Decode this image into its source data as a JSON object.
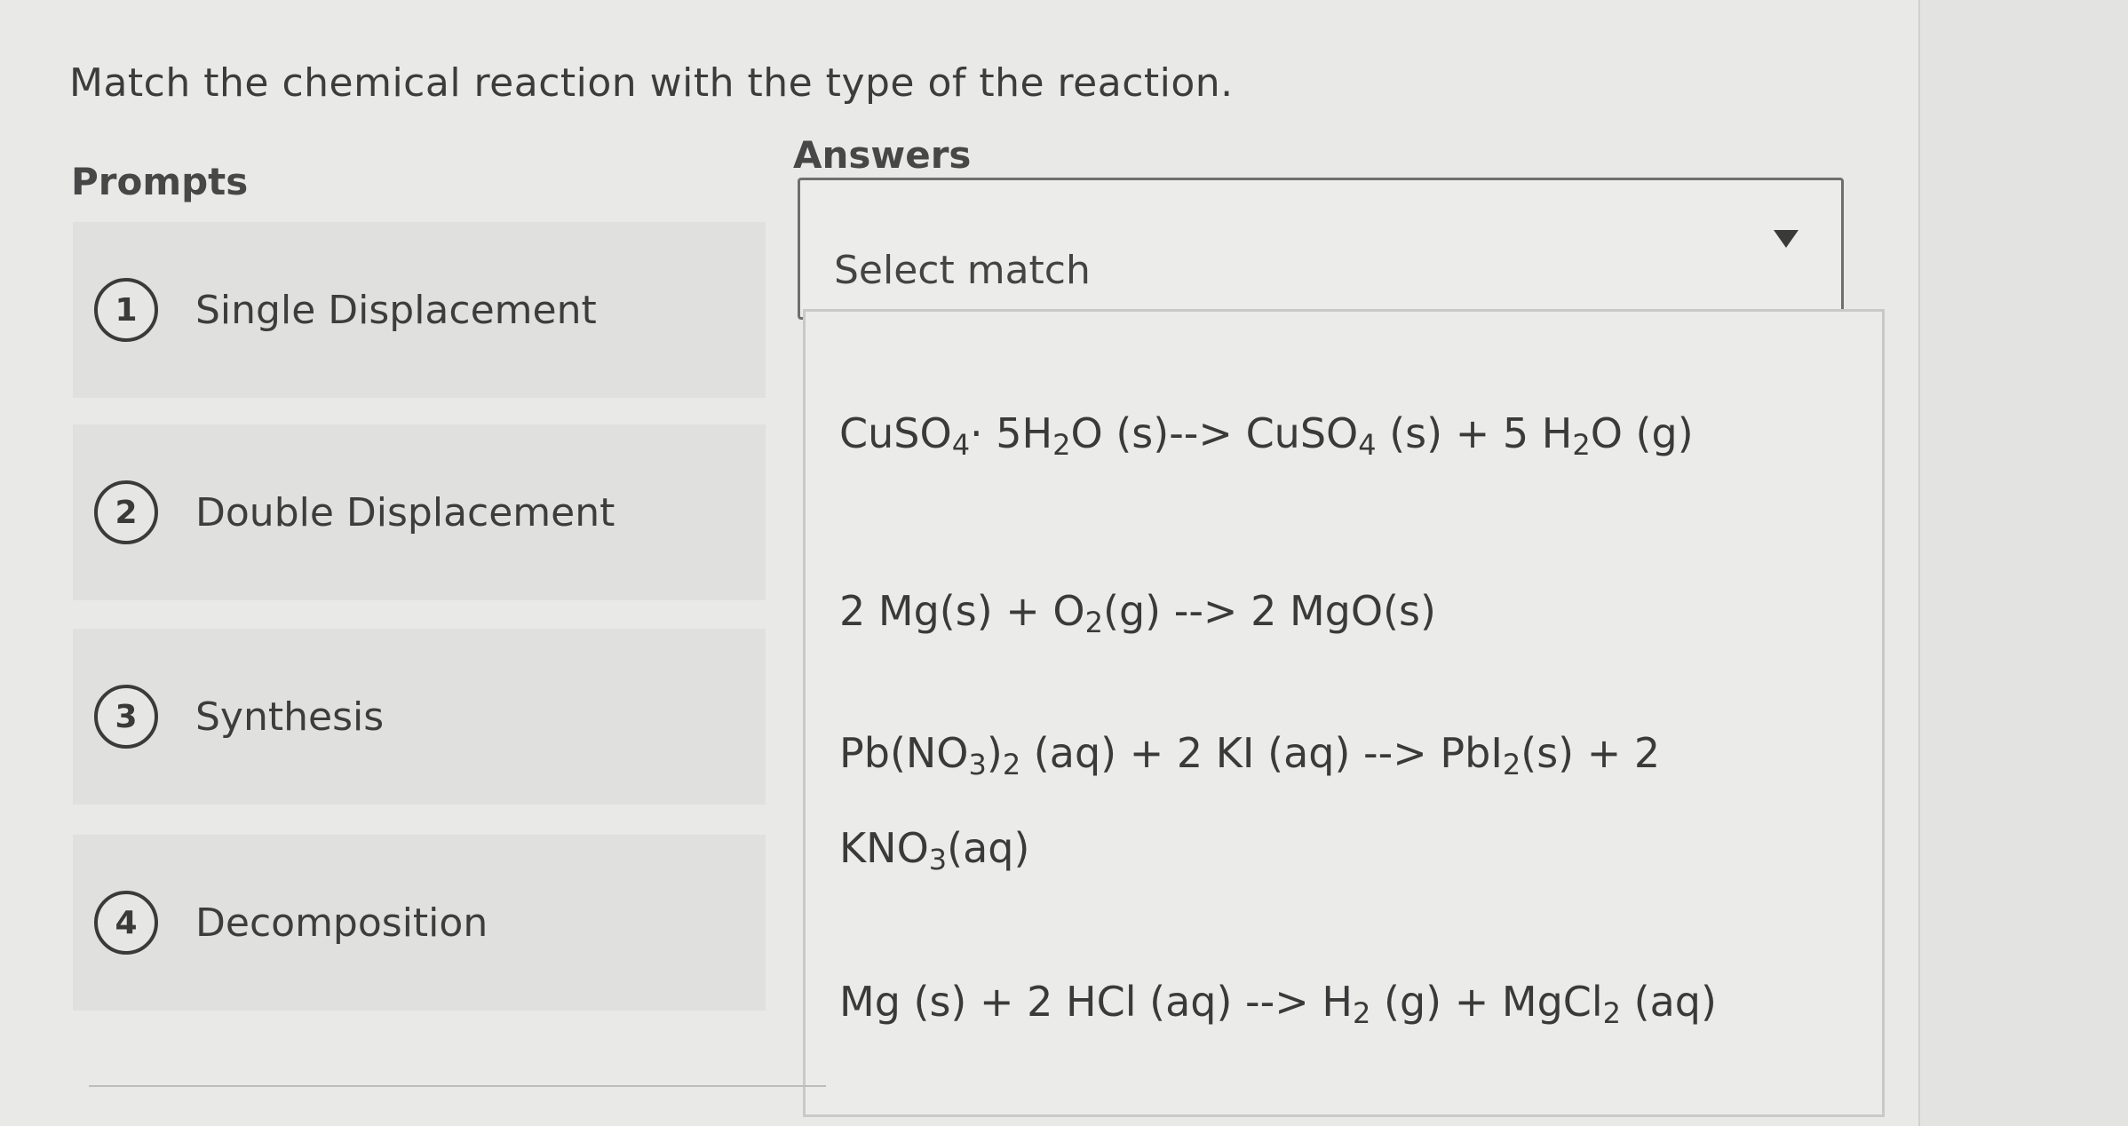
{
  "question": "Match the chemical reaction with the type of the reaction.",
  "prompts_heading": "Prompts",
  "answers_heading": "Answers",
  "prompts": [
    {
      "number": "1",
      "label": "Single Displacement"
    },
    {
      "number": "2",
      "label": "Double Displacement"
    },
    {
      "number": "3",
      "label": "Synthesis"
    },
    {
      "number": "4",
      "label": "Decomposition"
    }
  ],
  "select": {
    "placeholder": "Select match",
    "icon": "caret-down-icon"
  },
  "options": [
    {
      "parts": [
        [
          "CuSO",
          "4"
        ],
        [
          "· 5H",
          "2"
        ],
        [
          "O (s)--> CuSO",
          "4"
        ],
        [
          " (s) + 5 H",
          "2"
        ],
        [
          "O (g)",
          ""
        ]
      ]
    },
    {
      "parts": [
        [
          "2 Mg(s) + O",
          "2"
        ],
        [
          "(g) --> 2 MgO(s)",
          ""
        ]
      ]
    },
    {
      "parts": [
        [
          "Pb(NO",
          "3"
        ],
        [
          ")",
          "2"
        ],
        [
          " (aq) + 2 KI (aq) --> PbI",
          "2"
        ],
        [
          "(s) + 2 KNO",
          "3"
        ],
        [
          "(aq)",
          ""
        ]
      ]
    },
    {
      "parts": [
        [
          "Mg (s) + 2 HCl (aq) --> H",
          "2"
        ],
        [
          " (g) + MgCl",
          "2"
        ],
        [
          " (aq)",
          ""
        ]
      ]
    }
  ]
}
